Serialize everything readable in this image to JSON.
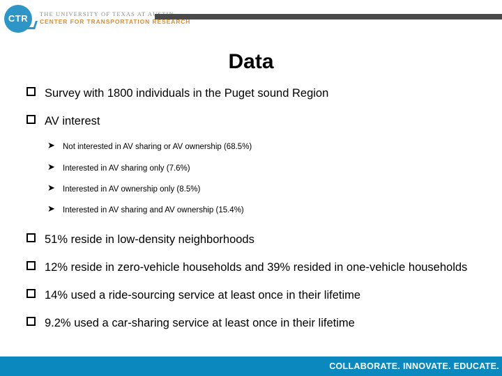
{
  "header": {
    "logo_initials": "CTR",
    "university_line": "THE UNIVERSITY OF TEXAS AT AUSTIN",
    "center_line": "CENTER FOR TRANSPORTATION RESEARCH",
    "rule_color": "#4a4a4a",
    "logo_color": "#2E96C6",
    "center_line_color": "#E08A2E"
  },
  "slide": {
    "title": "Data"
  },
  "bullets": {
    "b1": "Survey with 1800 individuals  in the Puget sound Region",
    "b2": "AV interest",
    "sub": [
      "Not interested in AV sharing or AV ownership (68.5%)",
      "Interested in AV sharing only (7.6%)",
      "Interested in AV ownership only (8.5%)",
      "Interested in AV sharing and AV ownership (15.4%)"
    ],
    "b3": "51% reside in low-density neighborhoods",
    "b4": "12% reside in zero-vehicle households and 39% resided in one-vehicle households",
    "b5": "14% used a ride-sourcing service at least once in their lifetime",
    "b6": "9.2% used a car-sharing service at least once in their lifetime"
  },
  "footer": {
    "tagline": "COLLABORATE. INNOVATE. EDUCATE.",
    "bar_color": "#0B89BE"
  }
}
